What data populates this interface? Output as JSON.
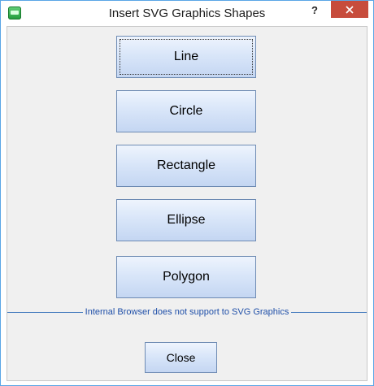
{
  "window": {
    "title": "Insert SVG Graphics Shapes",
    "help_label": "?",
    "icon": "app-icon",
    "close_icon": "close-x-icon",
    "close_color": "#c74c3c"
  },
  "shapes": {
    "line": "Line",
    "circle": "Circle",
    "rectangle": "Rectangle",
    "ellipse": "Ellipse",
    "polygon": "Polygon"
  },
  "notice": "Internal Browser does not support to SVG Graphics",
  "close_button": "Close",
  "colors": {
    "button_top": "#eef4fd",
    "button_bottom": "#c4d6f2",
    "button_border": "#6e8bb3",
    "notice_text": "#1f4fa8",
    "separator": "#4a7fbf"
  }
}
